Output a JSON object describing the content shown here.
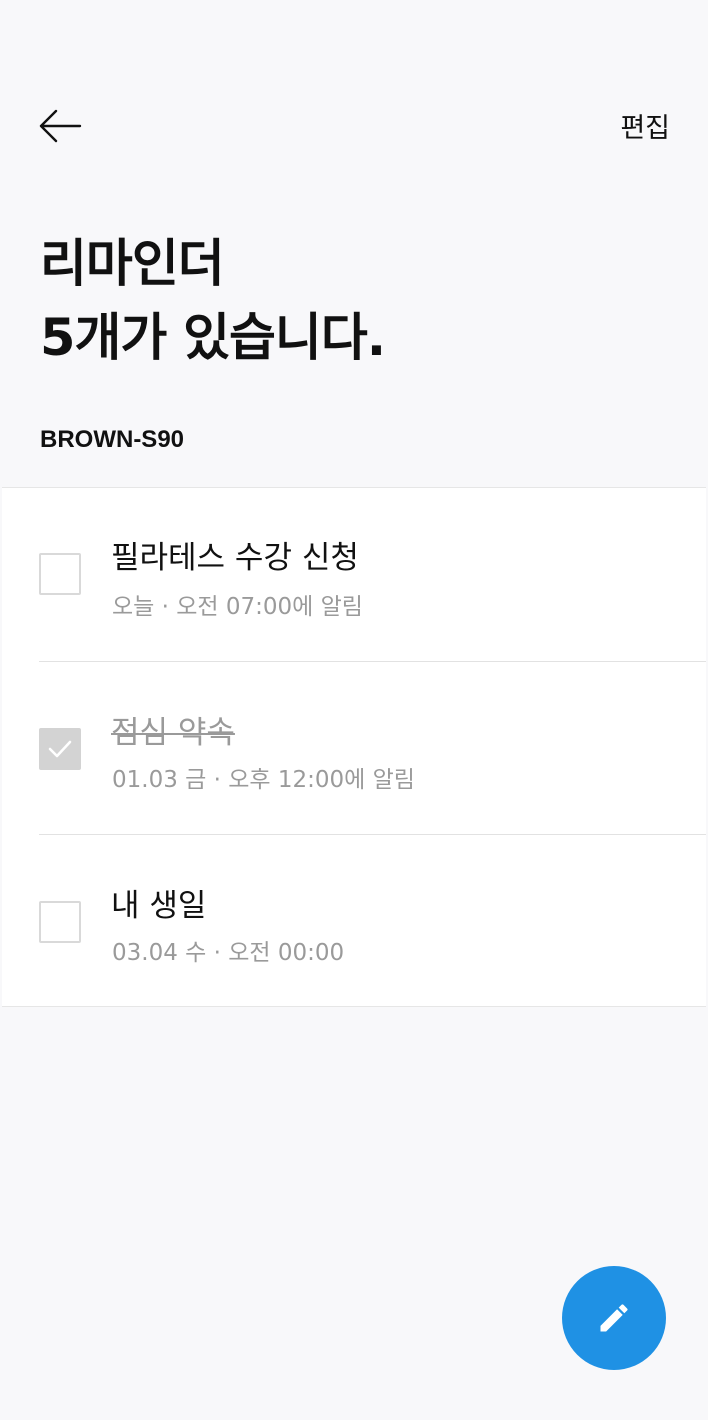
{
  "header": {
    "back_icon": "arrow-left-icon",
    "edit_label": "편집"
  },
  "title": {
    "line1": "리마인더",
    "line2": "5개가 있습니다."
  },
  "device_name": "BROWN-S90",
  "reminders": [
    {
      "title": "필라테스 수강 신청",
      "subtitle": "오늘 · 오전 07:00에 알림",
      "checked": false
    },
    {
      "title": "점심 약속",
      "subtitle": "01.03 금 · 오후 12:00에 알림",
      "checked": true
    },
    {
      "title": "내 생일",
      "subtitle": "03.04 수 · 오전 00:00",
      "checked": false
    }
  ],
  "fab": {
    "icon": "pencil-icon"
  },
  "colors": {
    "background": "#f8f8fa",
    "accent": "#1f91e4",
    "muted_text": "#9a9a9a",
    "checked_box": "#d3d3d3"
  }
}
